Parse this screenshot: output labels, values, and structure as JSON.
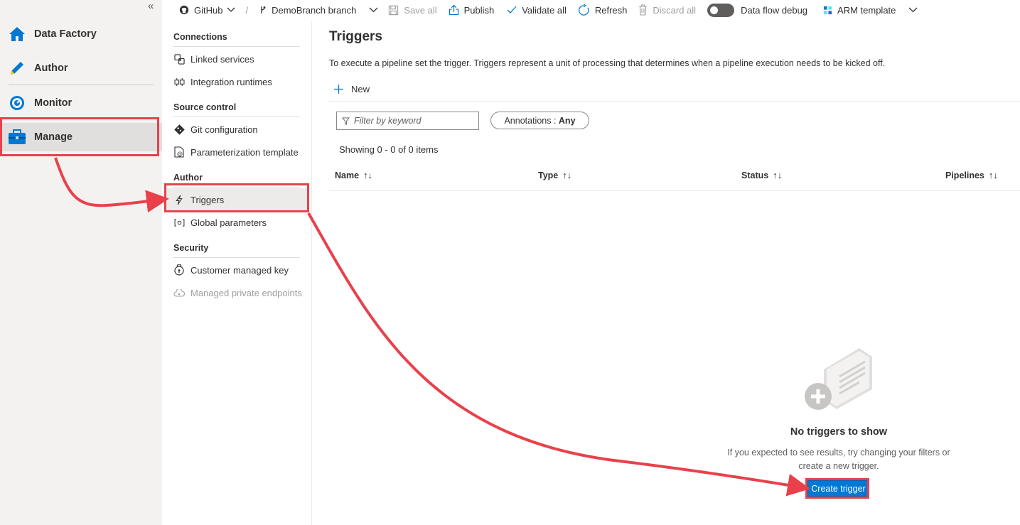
{
  "leftnav": {
    "collapse_glyph": "«",
    "items": [
      {
        "label": "Data Factory",
        "icon": "home-icon"
      },
      {
        "label": "Author",
        "icon": "pencil-icon"
      },
      {
        "label": "Monitor",
        "icon": "monitor-gauge-icon"
      },
      {
        "label": "Manage",
        "icon": "toolbox-icon",
        "selected": true
      }
    ]
  },
  "toolbar": {
    "repo": "GitHub",
    "separator": "/",
    "branch": "DemoBranch branch",
    "save_all": "Save all",
    "publish": "Publish",
    "validate_all": "Validate all",
    "refresh": "Refresh",
    "discard_all": "Discard all",
    "data_flow_debug": "Data flow debug",
    "arm_template": "ARM template"
  },
  "subnav": {
    "sections": [
      {
        "heading": "Connections",
        "items": [
          {
            "label": "Linked services",
            "icon": "linked-services-icon"
          },
          {
            "label": "Integration runtimes",
            "icon": "integration-runtime-icon"
          }
        ]
      },
      {
        "heading": "Source control",
        "items": [
          {
            "label": "Git configuration",
            "icon": "git-icon"
          },
          {
            "label": "Parameterization template",
            "icon": "template-icon"
          }
        ]
      },
      {
        "heading": "Author",
        "items": [
          {
            "label": "Triggers",
            "icon": "lightning-icon",
            "selected": true
          },
          {
            "label": "Global parameters",
            "icon": "parameters-icon"
          }
        ]
      },
      {
        "heading": "Security",
        "items": [
          {
            "label": "Customer managed key",
            "icon": "key-lock-icon"
          },
          {
            "label": "Managed private endpoints",
            "icon": "cloud-icon",
            "disabled": true
          }
        ]
      }
    ]
  },
  "main": {
    "title": "Triggers",
    "description": "To execute a pipeline set the trigger. Triggers represent a unit of processing that determines when a pipeline execution needs to be kicked off.",
    "new_label": "New",
    "filter_placeholder": "Filter by keyword",
    "annotations_label": "Annotations : ",
    "annotations_value": "Any",
    "showing": "Showing 0 - 0 of 0 items",
    "columns": [
      "Name",
      "Type",
      "Status",
      "Pipelines"
    ],
    "empty_title": "No triggers to show",
    "empty_desc_line1": "If you expected to see results, try changing your filters or",
    "empty_desc_line2": "create a new trigger.",
    "create_button": "Create trigger"
  },
  "colors": {
    "accent": "#0078d4",
    "annotation_red": "#e8414b",
    "nav_bg": "#f3f2f1"
  }
}
